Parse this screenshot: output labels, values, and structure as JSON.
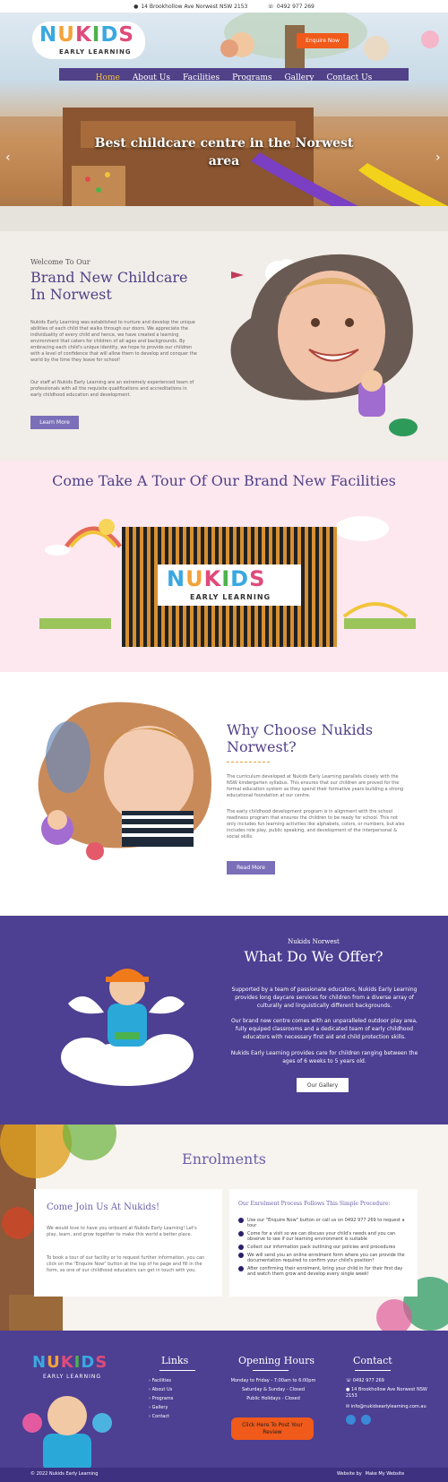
{
  "topbar": {
    "address": "14 Brookhollow Ave Norwest NSW 2153",
    "phone": "0492 977 269"
  },
  "brand": {
    "logo": "NUKIDS",
    "logo_sub": "EARLY LEARNING",
    "colors": {
      "primary": "#504188",
      "accent": "#f05a1a",
      "highlight": "#f2c43a"
    }
  },
  "header": {
    "enquire_label": "Enquire Now"
  },
  "nav": {
    "items": [
      {
        "label": "Home"
      },
      {
        "label": "About Us"
      },
      {
        "label": "Facilities"
      },
      {
        "label": "Programs"
      },
      {
        "label": "Gallery"
      },
      {
        "label": "Contact Us"
      }
    ]
  },
  "hero": {
    "headline": "Best childcare centre in the Norwest area"
  },
  "intro": {
    "welcome": "Welcome To Our",
    "title": "Brand New Childcare In Norwest",
    "p1": "Nukids Early Learning was established to nurture and develop the unique abilities of each child that walks through our doors. We appreciate the individuality of every child and hence, we have created a learning environment that caters for children of all ages and backgrounds. By embracing each child's unique identity, we hope to provide our children with a level of confidence that will allow them to develop and conquer the world by the time they leave for school!",
    "p2": "Our staff at Nukids Early Learning are an extremely experienced team of professionals with all the requisite qualifications and accreditations in early childhood education and development.",
    "button": "Learn More"
  },
  "tour": {
    "title": "Come Take A Tour Of Our Brand New Facilities",
    "sign_logo": "NUKIDS",
    "sign_sub": "EARLY LEARNING"
  },
  "why": {
    "title": "Why Choose Nukids Norwest?",
    "p1": "The curriculum developed at Nukids Early Learning parallels closely with the NSW kindergarten syllabus. This ensures that our children are proved for the formal education system as they spend their formative years building a strong educational foundation at our centre.",
    "p2": "The early childhood development program is in alignment with the school readiness program that ensures the children to be ready for school. This not only includes fun learning activities like alphabets, colors, or numbers, but also includes role play, public speaking, and development of the interpersonal & social skills.",
    "button": "Read More"
  },
  "offer": {
    "kicker": "Nukids Norwest",
    "title": "What Do We Offer?",
    "p1": "Supported by a team of passionate educators, Nukids Early Learning provides long daycare services for children from a diverse array of culturally and linguistically different backgrounds.",
    "p2": "Our brand new centre comes with an unparalleled outdoor play area, fully equiped classrooms and a dedicated team of early childhood educators with necessary first aid and child protection skills.",
    "p3": "Nukids Early Learning provides care for children ranging between the ages of 6 weeks to 5 years old.",
    "button": "Our Gallery"
  },
  "enrol": {
    "title": "Enrolments",
    "join_title": "Come Join Us At Nukids!",
    "join_p1": "We would love to have you onboard at Nukids Early Learning! Let's play, learn, and grow together to make this world a better place.",
    "join_p2": "To book a tour of our facility or to request further information, you can click on the \"Enquire Now\" button at the top of he page and fill in the form, so one of our childhood educators can get in touch with you.",
    "process_title": "Our Enrolment Process Follows This Simple Procedure:",
    "steps": [
      "Use our \"Enquire Now\" button or call us on 0492 977 269 to request a tour",
      "Come for a visit so we can discuss your child's needs and you can observe to see if our learning environment is suitable",
      "Collect our information pack outlining our policies and procedures",
      "We will send you an online enrolment form where you can provide the documentation required to confirm your child's position!",
      "After confirming their enrolment, bring your child in for their first day and watch them grow and develop every single week!"
    ]
  },
  "footer": {
    "logo": "NUKIDS",
    "logo_sub": "EARLY LEARNING",
    "links_title": "Links",
    "links": [
      "Facilities",
      "About Us",
      "Programs",
      "Gallery",
      "Contact"
    ],
    "hours_title": "Opening Hours",
    "hours": [
      "Monday to Friday - 7:00am to 6:00pm",
      "Saturday & Sunday - Closed",
      "Public Holidays - Closed"
    ],
    "review_button": "Click Here To Post Your Review",
    "contact_title": "Contact",
    "phone": "0492 977 269",
    "address": "14 Brookhollow Ave Norwest NSW 2153",
    "email": "info@nukidsearlylearning.com.au",
    "copyright": "© 2022 Nukids Early Learning",
    "credit": "Website by",
    "credit_brand": "Make My Website"
  }
}
